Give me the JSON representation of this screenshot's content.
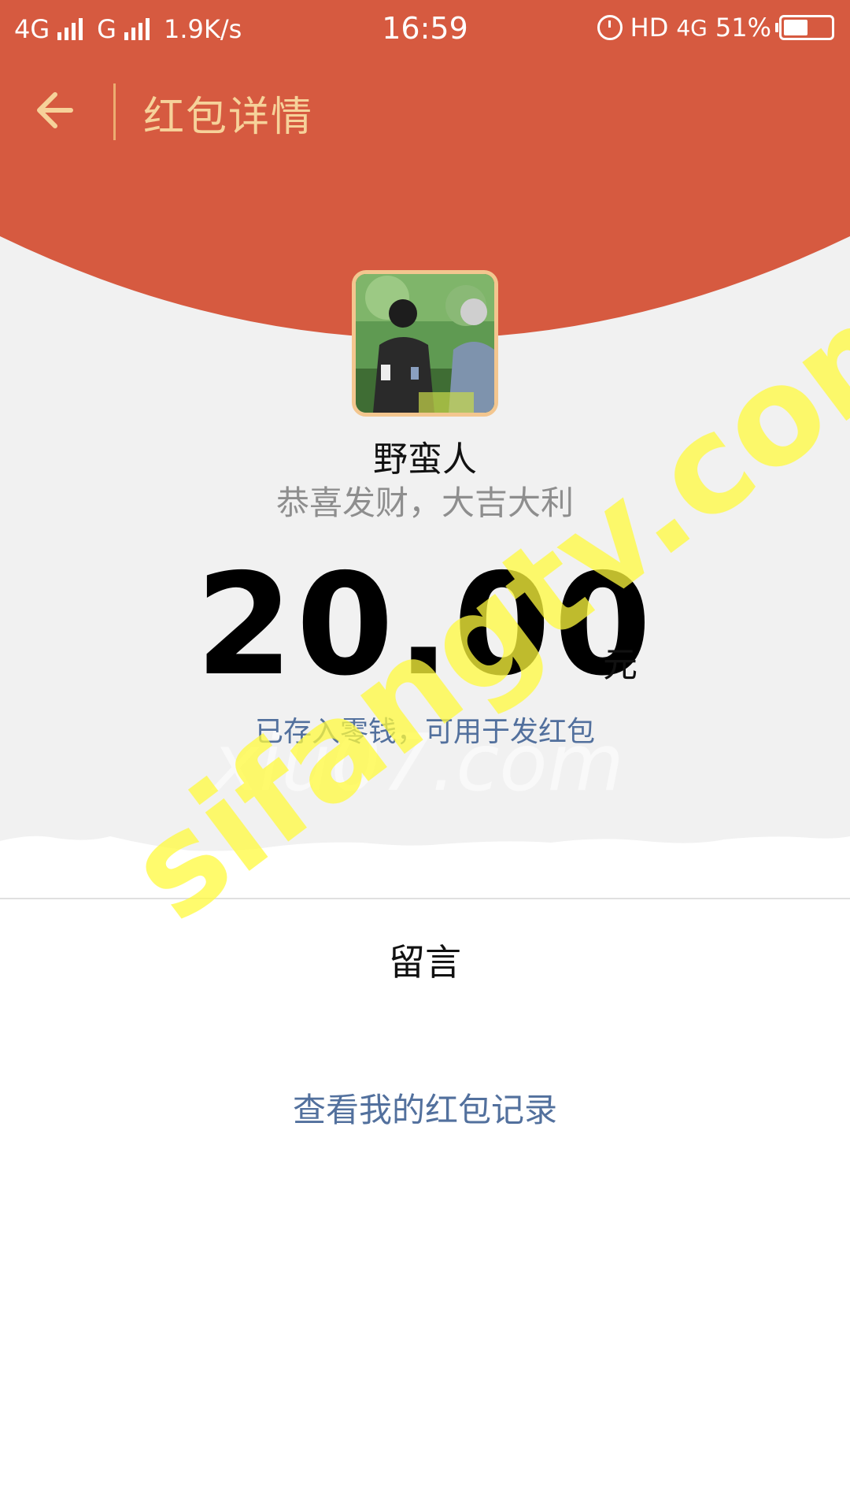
{
  "status_bar": {
    "network_1": "4G",
    "network_2": "G",
    "speed": "1.9K/s",
    "time": "16:59",
    "hd": "HD",
    "network_3": "4G",
    "battery": "51%"
  },
  "nav": {
    "title": "红包详情",
    "back_icon": "arrow-left-icon"
  },
  "red_packet": {
    "sender_name": "野蛮人",
    "greeting": "恭喜发财，大吉大利",
    "amount": "20.00",
    "unit": "元",
    "deposit_note": "已存入零钱，可用于发红包"
  },
  "message_section": {
    "label": "留言"
  },
  "records_link": "查看我的红包记录",
  "watermarks": {
    "gray": "xiu07.com",
    "yellow": "sifangtv.com"
  },
  "colors": {
    "header_red": "#d65a40",
    "title_gold": "#f6d29a",
    "link_blue": "#52709d",
    "avatar_border": "#f3c68f"
  }
}
